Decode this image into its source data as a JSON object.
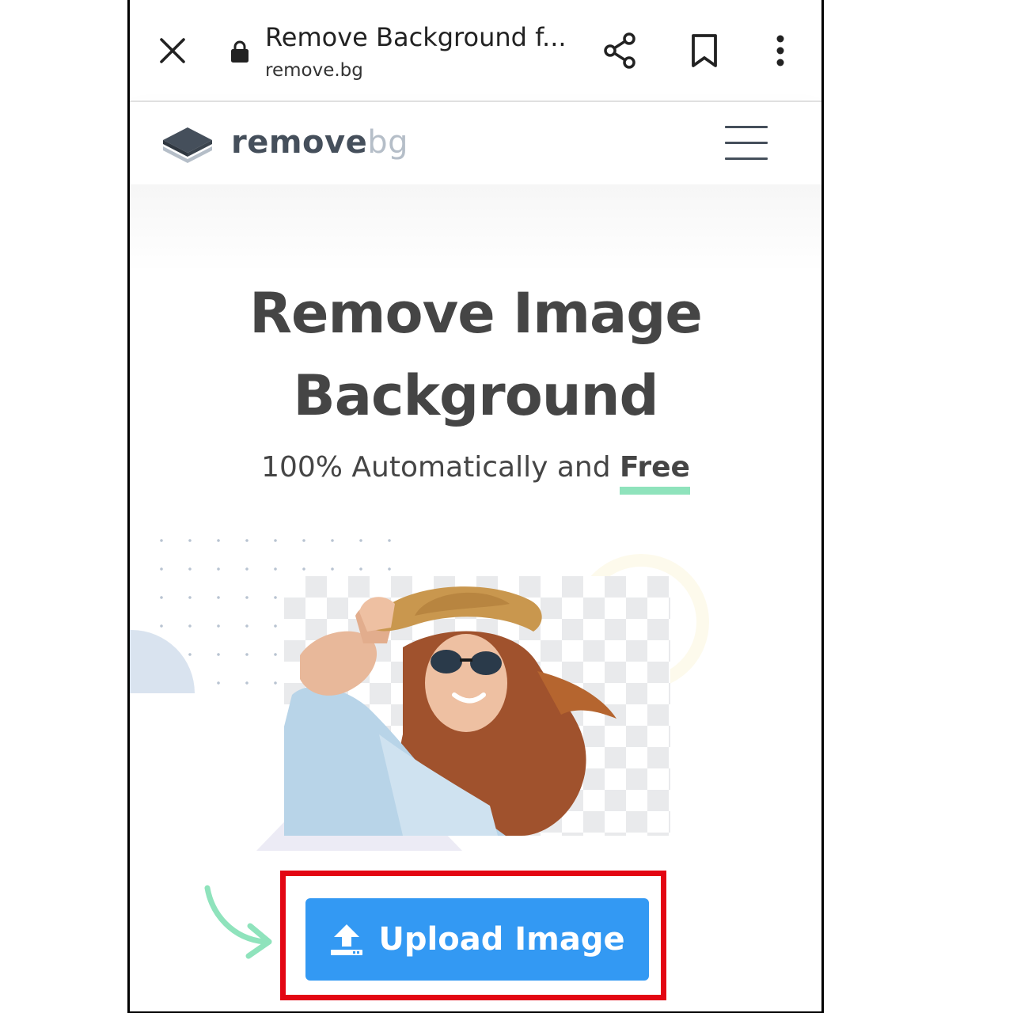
{
  "browser": {
    "title": "Remove Background f...",
    "url": "remove.bg",
    "icons": [
      "close-icon",
      "lock-icon",
      "share-icon",
      "bookmark-icon",
      "more-vert-icon"
    ]
  },
  "site": {
    "logo_remove": "remove",
    "logo_bg": "bg",
    "menu_icon": "hamburger-menu-icon"
  },
  "hero": {
    "title_line1": "Remove Image",
    "title_line2": "Background",
    "subtitle_prefix": "100% Automatically and",
    "subtitle_free": "Free"
  },
  "upload": {
    "button_label": "Upload Image",
    "icon": "upload-icon"
  },
  "colors": {
    "accent_blue": "#3399f3",
    "free_underline": "#8fe3bc",
    "highlight_red": "#e30613",
    "arrow_green": "#8fe3bc",
    "text_dark": "#454545"
  }
}
